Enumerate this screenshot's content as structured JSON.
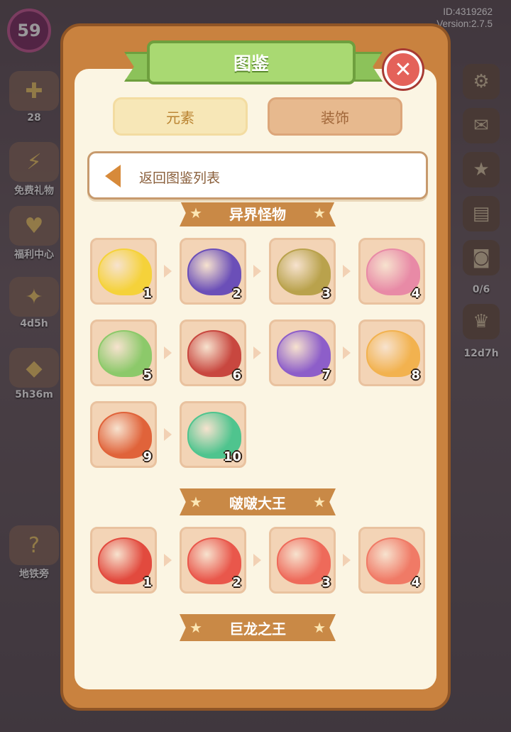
{
  "hud": {
    "level": "59",
    "id_line": "ID:4319262",
    "version_line": "Version:2.7.5",
    "left_items": [
      {
        "icon": "clover-icon",
        "label": "28"
      },
      {
        "icon": "gift-icon",
        "label": "免费礼物"
      },
      {
        "icon": "welfare-icon",
        "label": "福利中心"
      },
      {
        "icon": "event-icon",
        "label": "4d5h"
      },
      {
        "icon": "shop-icon",
        "label": "5h36m"
      },
      {
        "icon": "metro-icon",
        "label": "地铁旁"
      }
    ],
    "right_items": [
      {
        "icon": "settings-icon",
        "label": ""
      },
      {
        "icon": "mail-icon",
        "label": ""
      },
      {
        "icon": "trophy-icon",
        "label": ""
      },
      {
        "icon": "book-icon",
        "label": ""
      },
      {
        "icon": "jar-icon",
        "label": "0/6"
      },
      {
        "icon": "crown-icon",
        "label": "12d7h"
      }
    ]
  },
  "modal": {
    "title": "图鉴",
    "tabs": [
      {
        "label": "元素",
        "active": true
      },
      {
        "label": "装饰",
        "active": false
      }
    ],
    "back_label": "返回图鉴列表",
    "sections": [
      {
        "title": "异界怪物",
        "items": [
          {
            "level": "1",
            "color": "#f5d23a"
          },
          {
            "level": "2",
            "color": "#6b4fb8"
          },
          {
            "level": "3",
            "color": "#b9a24c"
          },
          {
            "level": "4",
            "color": "#e88aa6"
          },
          {
            "level": "5",
            "color": "#8cc96a"
          },
          {
            "level": "6",
            "color": "#c8473f"
          },
          {
            "level": "7",
            "color": "#8d5ec9"
          },
          {
            "level": "8",
            "color": "#f2b24f"
          },
          {
            "level": "9",
            "color": "#e0633a"
          },
          {
            "level": "10",
            "color": "#4fc48e"
          }
        ]
      },
      {
        "title": "啵啵大王",
        "items": [
          {
            "level": "1",
            "color": "#e24a3e"
          },
          {
            "level": "2",
            "color": "#e9574b"
          },
          {
            "level": "3",
            "color": "#ee6a5a"
          },
          {
            "level": "4",
            "color": "#f07a66"
          }
        ]
      },
      {
        "title": "巨龙之王",
        "items": []
      }
    ]
  }
}
